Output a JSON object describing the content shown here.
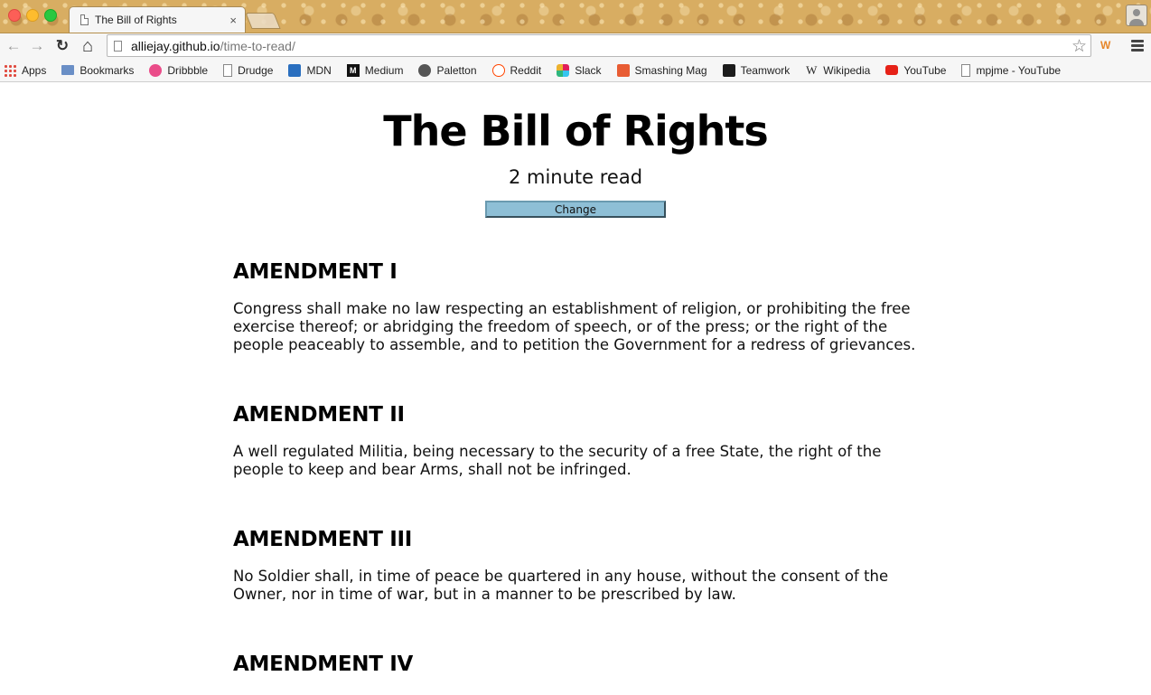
{
  "browser": {
    "tab_title": "The Bill of Rights",
    "tab_close": "×",
    "url_host": "alliejay.github.io",
    "url_path": "/time-to-read/",
    "nav": {
      "back_glyph": "←",
      "forward_glyph": "→",
      "reload_glyph": "↻",
      "home_glyph": "⌂"
    },
    "star_glyph": "☆",
    "extension_label": "W",
    "bookmarks": [
      {
        "label": "Apps",
        "icon": "apps-icon",
        "glyph": ""
      },
      {
        "label": "Bookmarks",
        "icon": "folder-icon",
        "glyph": ""
      },
      {
        "label": "Dribbble",
        "icon": "dribbble-icon",
        "glyph": ""
      },
      {
        "label": "Drudge",
        "icon": "document-icon",
        "glyph": ""
      },
      {
        "label": "MDN",
        "icon": "mdn-icon",
        "glyph": ""
      },
      {
        "label": "Medium",
        "icon": "medium-icon",
        "glyph": "M"
      },
      {
        "label": "Paletton",
        "icon": "paletton-icon",
        "glyph": ""
      },
      {
        "label": "Reddit",
        "icon": "reddit-icon",
        "glyph": ""
      },
      {
        "label": "Slack",
        "icon": "slack-icon",
        "glyph": ""
      },
      {
        "label": "Smashing Mag",
        "icon": "smashing-icon",
        "glyph": ""
      },
      {
        "label": "Teamwork",
        "icon": "teamwork-icon",
        "glyph": ""
      },
      {
        "label": "Wikipedia",
        "icon": "wikipedia-icon",
        "glyph": "W"
      },
      {
        "label": "YouTube",
        "icon": "youtube-icon",
        "glyph": ""
      },
      {
        "label": "mpjme - YouTube",
        "icon": "document-icon",
        "glyph": ""
      }
    ]
  },
  "page": {
    "title": "The Bill of Rights",
    "read_time": "2 minute read",
    "change_label": "Change",
    "amendments": [
      {
        "heading": "AMENDMENT I",
        "text": "Congress shall make no law respecting an establishment of religion, or prohibiting the free exercise thereof; or abridging the freedom of speech, or of the press; or the right of the people peaceably to assemble, and to petition the Government for a redress of grievances."
      },
      {
        "heading": "AMENDMENT II",
        "text": "A well regulated Militia, being necessary to the security of a free State, the right of the people to keep and bear Arms, shall not be infringed."
      },
      {
        "heading": "AMENDMENT III",
        "text": "No Soldier shall, in time of peace be quartered in any house, without the consent of the Owner, nor in time of war, but in a manner to be prescribed by law."
      },
      {
        "heading": "AMENDMENT IV",
        "text": ""
      }
    ]
  }
}
